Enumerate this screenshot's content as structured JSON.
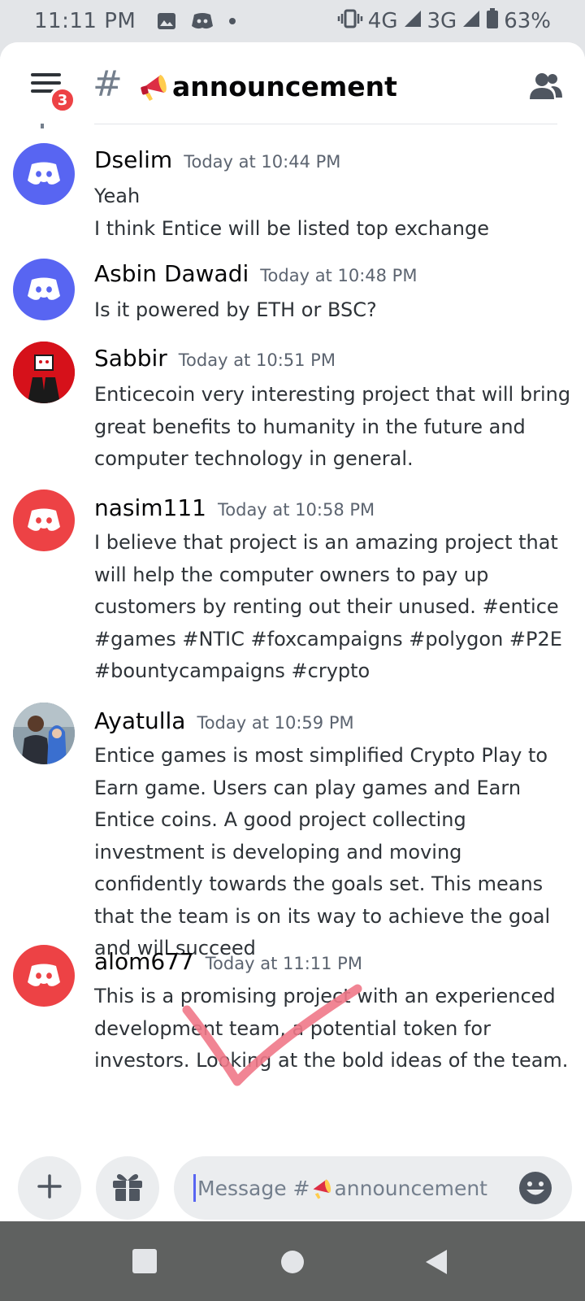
{
  "status_bar": {
    "time": "11:11 PM",
    "network_4g": "4G",
    "network_3g": "3G",
    "battery": "63%"
  },
  "header": {
    "badge_count": "3",
    "hash_symbol": "#",
    "channel_name": "announcement",
    "channel_emoji_icon": "megaphone-icon"
  },
  "messages": [
    {
      "username": "Dselim",
      "timestamp": "Today at 10:44 PM",
      "lines": [
        "Yeah",
        "I think Entice will be listed top exchange"
      ],
      "avatar": "discord-icon",
      "avatar_color": "#5865f2"
    },
    {
      "username": "Asbin Dawadi",
      "timestamp": "Today at 10:48 PM",
      "lines": [
        "Is it powered by ETH or BSC?"
      ],
      "avatar": "discord-icon",
      "avatar_color": "#5865f2"
    },
    {
      "username": "Sabbir",
      "timestamp": "Today at 10:51 PM",
      "lines": [
        "Enticecoin very interesting project that will bring great benefits to humanity in the future and computer technology in general."
      ],
      "avatar": "custom-avatar",
      "avatar_color": "#d6111a"
    },
    {
      "username": "nasim111",
      "timestamp": "Today at 10:58 PM",
      "lines": [
        "I believe that project is an amazing project that will help the computer owners to pay up customers by renting out their unused. #entice #games #NTIC #foxcampaigns #polygon #P2E #bountycampaigns #crypto"
      ],
      "avatar": "discord-icon",
      "avatar_color": "#ed4245"
    },
    {
      "username": "Ayatulla",
      "timestamp": "Today at 10:59 PM",
      "lines": [
        "Entice games is most simplified Crypto Play to Earn game. Users can play games and Earn Entice coins. A good project collecting investment is developing and moving confidently towards the goals set. This means that the team is on its way to achieve the goal and will succeed"
      ],
      "avatar": "photo-avatar",
      "avatar_color": "#6b7f8c"
    },
    {
      "username": "alom677",
      "timestamp": "Today at 11:11 PM",
      "lines": [
        "This is a promising project with an experienced development team, a potential token for investors. Looking at the bold ideas of the team."
      ],
      "avatar": "discord-icon",
      "avatar_color": "#ed4245"
    }
  ],
  "composer": {
    "placeholder_prefix": "Message #",
    "placeholder_channel": "announcement",
    "add_icon": "plus-icon",
    "gift_icon": "gift-icon",
    "emoji_icon": "smiley-icon"
  },
  "colors": {
    "blurple": "#5865f2",
    "red": "#ed4245",
    "check_overlay": "#f07888"
  }
}
